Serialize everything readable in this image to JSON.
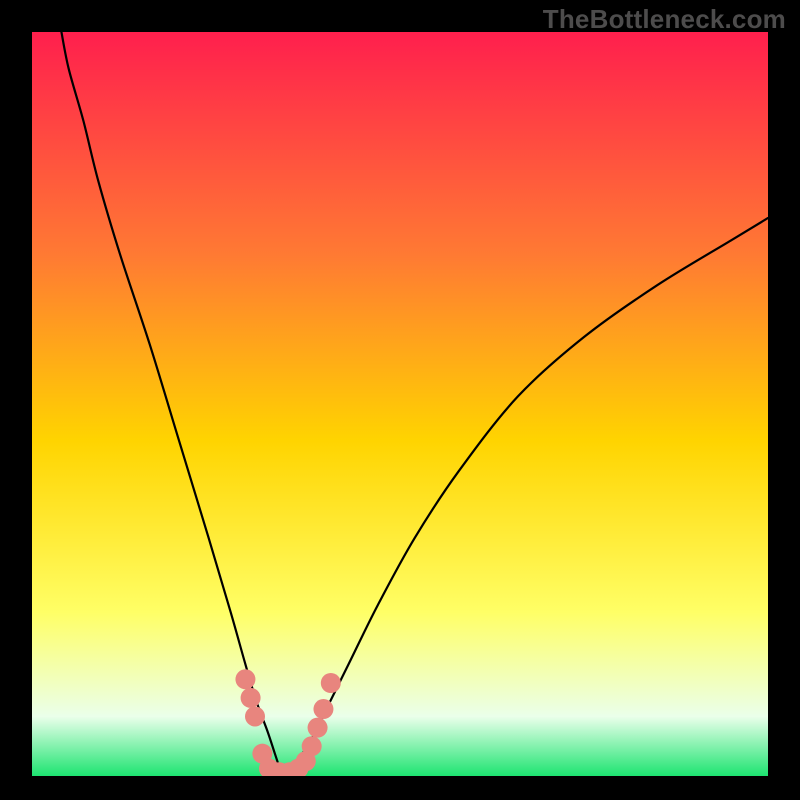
{
  "watermark": "TheBottleneck.com",
  "colors": {
    "frame": "#000000",
    "watermark": "#4d4c4c",
    "curve": "#000000",
    "marker": "#e8857e",
    "gradient_top": "#ff1f4d",
    "gradient_mid1": "#ff7a33",
    "gradient_mid2": "#ffd400",
    "gradient_mid3": "#ffff66",
    "gradient_pale": "#eaffea",
    "gradient_bottom": "#1de471"
  },
  "chart_data": {
    "type": "line",
    "title": "",
    "xlabel": "",
    "ylabel": "",
    "xlim": [
      0,
      100
    ],
    "ylim": [
      0,
      100
    ],
    "grid": false,
    "legend": false,
    "background": "vertical-gradient",
    "curve_note": "V-shaped bottleneck curve; y is estimated percent bottleneck vs an unlabeled x-axis. Left branch is near-vertical, right branch rises asymptotically.",
    "series": [
      {
        "name": "bottleneck-curve-left",
        "x": [
          4,
          5,
          7,
          9,
          12,
          16,
          20,
          24,
          27,
          29,
          30.5,
          32,
          33,
          34
        ],
        "values": [
          100,
          95,
          88,
          80,
          70,
          58,
          45,
          32,
          22,
          15,
          10,
          6,
          3,
          0
        ]
      },
      {
        "name": "bottleneck-curve-right",
        "x": [
          34,
          36,
          38,
          40,
          43,
          47,
          52,
          58,
          66,
          75,
          85,
          95,
          100
        ],
        "values": [
          0,
          2,
          5,
          9,
          15,
          23,
          32,
          41,
          51,
          59,
          66,
          72,
          75
        ]
      }
    ],
    "markers": {
      "name": "highlighted-points",
      "color": "#e8857e",
      "radius_px": 10,
      "points": [
        {
          "x": 29.0,
          "y": 13.0
        },
        {
          "x": 29.7,
          "y": 10.5
        },
        {
          "x": 30.3,
          "y": 8.0
        },
        {
          "x": 31.3,
          "y": 3.0
        },
        {
          "x": 32.2,
          "y": 1.0
        },
        {
          "x": 33.6,
          "y": 0.5
        },
        {
          "x": 35.0,
          "y": 0.5
        },
        {
          "x": 36.2,
          "y": 1.0
        },
        {
          "x": 37.2,
          "y": 2.0
        },
        {
          "x": 38.0,
          "y": 4.0
        },
        {
          "x": 38.8,
          "y": 6.5
        },
        {
          "x": 39.6,
          "y": 9.0
        },
        {
          "x": 40.6,
          "y": 12.5
        }
      ]
    }
  }
}
